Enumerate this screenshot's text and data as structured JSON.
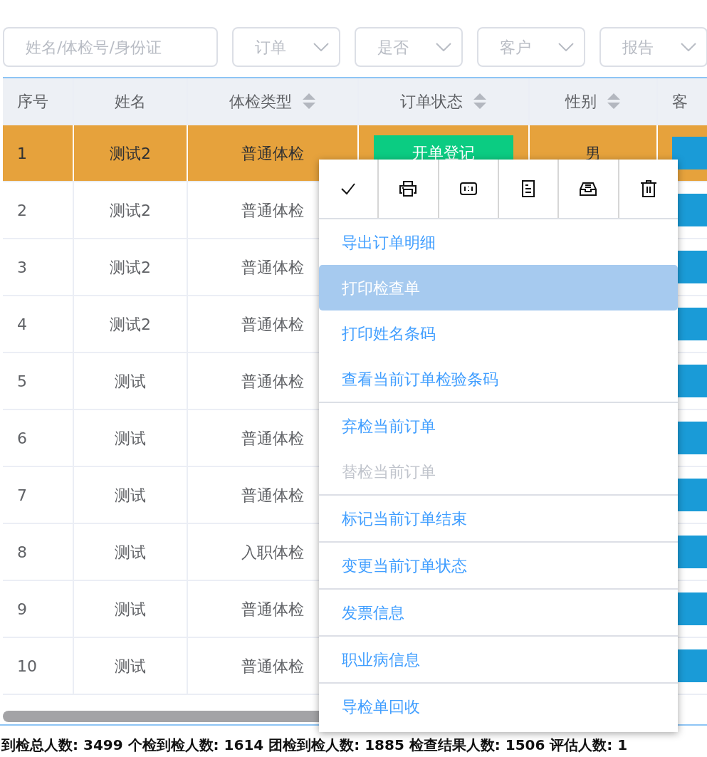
{
  "filters": {
    "search": {
      "placeholder": "姓名/体检号/身份证"
    },
    "selects": [
      {
        "placeholder": "订单"
      },
      {
        "placeholder": "是否"
      },
      {
        "placeholder": "客户"
      },
      {
        "placeholder": "报告"
      }
    ]
  },
  "table": {
    "columns": [
      {
        "label": "序号",
        "sortable": false
      },
      {
        "label": "姓名",
        "sortable": false
      },
      {
        "label": "体检类型",
        "sortable": true
      },
      {
        "label": "订单状态",
        "sortable": true
      },
      {
        "label": "性别",
        "sortable": true
      },
      {
        "label": "客",
        "sortable": false
      }
    ],
    "rows": [
      {
        "index": "1",
        "name": "测试2",
        "type": "普通体检",
        "status": "开单登记",
        "gender": "男",
        "selected": true
      },
      {
        "index": "2",
        "name": "测试2",
        "type": "普通体检",
        "selected": false
      },
      {
        "index": "3",
        "name": "测试2",
        "type": "普通体检",
        "selected": false
      },
      {
        "index": "4",
        "name": "测试2",
        "type": "普通体检",
        "selected": false
      },
      {
        "index": "5",
        "name": "测试",
        "type": "普通体检",
        "selected": false
      },
      {
        "index": "6",
        "name": "测试",
        "type": "普通体检",
        "selected": false
      },
      {
        "index": "7",
        "name": "测试",
        "type": "普通体检",
        "selected": false
      },
      {
        "index": "8",
        "name": "测试",
        "type": "入职体检",
        "selected": false
      },
      {
        "index": "9",
        "name": "测试",
        "type": "普通体检",
        "selected": false
      },
      {
        "index": "10",
        "name": "测试",
        "type": "普通体检",
        "selected": false
      }
    ]
  },
  "context_menu": {
    "groups": [
      {
        "items": [
          {
            "label": "导出订单明细",
            "selected": false,
            "disabled": false
          },
          {
            "label": "打印检查单",
            "selected": true,
            "disabled": false
          },
          {
            "label": "打印姓名条码",
            "selected": false,
            "disabled": false
          },
          {
            "label": "查看当前订单检验条码",
            "selected": false,
            "disabled": false
          }
        ]
      },
      {
        "items": [
          {
            "label": "弃检当前订单",
            "selected": false,
            "disabled": false
          },
          {
            "label": "替检当前订单",
            "selected": false,
            "disabled": true
          }
        ]
      },
      {
        "items": [
          {
            "label": "标记当前订单结束",
            "selected": false,
            "disabled": false
          }
        ]
      },
      {
        "items": [
          {
            "label": "变更当前订单状态",
            "selected": false,
            "disabled": false
          }
        ]
      },
      {
        "items": [
          {
            "label": "发票信息",
            "selected": false,
            "disabled": false
          }
        ]
      },
      {
        "items": [
          {
            "label": "职业病信息",
            "selected": false,
            "disabled": false
          }
        ]
      },
      {
        "items": [
          {
            "label": "导检单回收",
            "selected": false,
            "disabled": false
          }
        ]
      }
    ]
  },
  "summary": "到检总人数: 3499 个检到检人数: 1614 团检到检人数: 1885 检查结果人数: 1506 评估人数: 1"
}
